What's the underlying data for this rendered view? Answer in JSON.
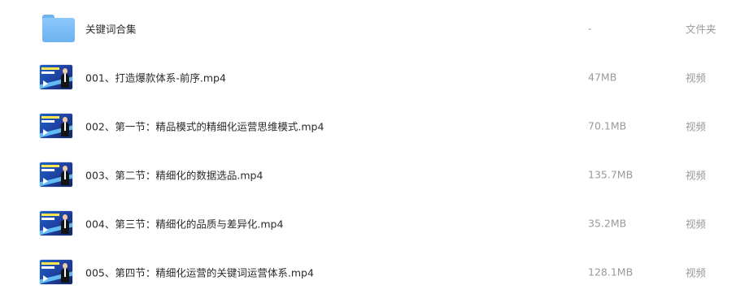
{
  "files": [
    {
      "name": "关键词合集",
      "size": "-",
      "type": "文件夹",
      "icon": "folder-icon"
    },
    {
      "name": "001、打造爆款体系-前序.mp4",
      "size": "47MB",
      "type": "视频",
      "icon": "video-thumbnail-icon"
    },
    {
      "name": "002、第一节：精品模式的精细化运营思维模式.mp4",
      "size": "70.1MB",
      "type": "视频",
      "icon": "video-thumbnail-icon"
    },
    {
      "name": "003、第二节：精细化的数据选品.mp4",
      "size": "135.7MB",
      "type": "视频",
      "icon": "video-thumbnail-icon"
    },
    {
      "name": "004、第三节：精细化的品质与差异化.mp4",
      "size": "35.2MB",
      "type": "视频",
      "icon": "video-thumbnail-icon"
    },
    {
      "name": "005、第四节：精细化运营的关键词运营体系.mp4",
      "size": "128.1MB",
      "type": "视频",
      "icon": "video-thumbnail-icon"
    }
  ],
  "colors": {
    "folder": "#7dbdf5",
    "thumbnail_bg": "#1f4fb0",
    "name_text": "#2b2b2b",
    "meta_text": "#999999"
  }
}
